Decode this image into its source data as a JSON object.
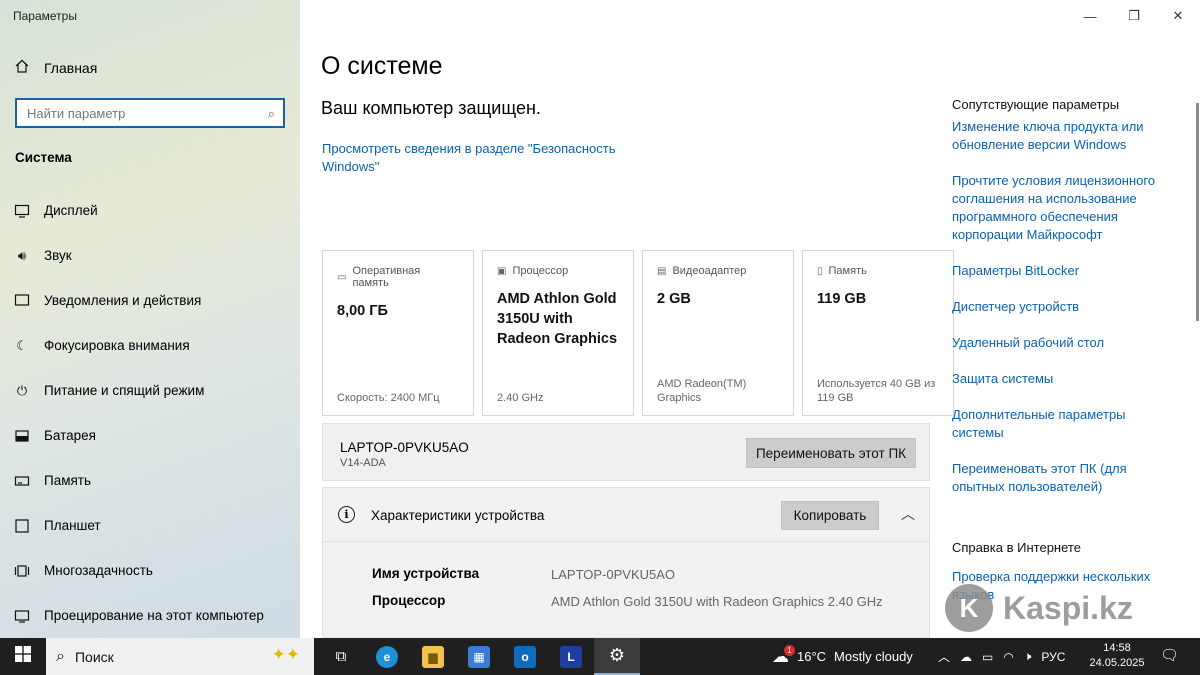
{
  "window": {
    "title": "Параметры",
    "controls": {
      "minimize": "—",
      "maximize": "❐",
      "close": "✕"
    }
  },
  "sidebar": {
    "home": {
      "icon": "home-icon",
      "label": "Главная"
    },
    "search": {
      "placeholder": "Найти параметр",
      "icon": "search-icon"
    },
    "section": "Система",
    "items": [
      {
        "icon": "display-icon",
        "label": "Дисплей"
      },
      {
        "icon": "sound-icon",
        "label": "Звук"
      },
      {
        "icon": "notifications-icon",
        "label": "Уведомления и действия"
      },
      {
        "icon": "focus-assist-icon",
        "label": "Фокусировка внимания"
      },
      {
        "icon": "power-icon",
        "label": "Питание и спящий режим"
      },
      {
        "icon": "battery-icon",
        "label": "Батарея"
      },
      {
        "icon": "storage-icon",
        "label": "Память"
      },
      {
        "icon": "tablet-icon",
        "label": "Планшет"
      },
      {
        "icon": "multitasking-icon",
        "label": "Многозадачность"
      },
      {
        "icon": "projecting-icon",
        "label": "Проецирование на этот компьютер"
      }
    ]
  },
  "main": {
    "title": "О системе",
    "protected": "Ваш компьютер защищен.",
    "security_link": "Просмотреть сведения в разделе \"Безопасность Windows\"",
    "cards": [
      {
        "icon": "ram-icon",
        "label": "Оперативная память",
        "value": "8,00 ГБ",
        "foot": "Скорость: 2400 МГц"
      },
      {
        "icon": "cpu-icon",
        "label": "Процессор",
        "value": "AMD Athlon Gold 3150U with Radeon Graphics",
        "foot": "2.40 GHz"
      },
      {
        "icon": "gpu-icon",
        "label": "Видеоадаптер",
        "value": "2 GB",
        "foot": "AMD Radeon(TM) Graphics"
      },
      {
        "icon": "storage-icon",
        "label": "Память",
        "value": "119 GB",
        "foot": "Используется 40 GB из 119 GB"
      }
    ],
    "pc": {
      "name": "LAPTOP-0PVKU5AO",
      "model": "V14-ADA",
      "rename_button": "Переименовать этот ПК"
    },
    "specs": {
      "title": "Характеристики устройства",
      "copy_button": "Копировать",
      "rows": [
        {
          "label": "Имя устройства",
          "value": "LAPTOP-0PVKU5AO"
        },
        {
          "label": "Процессор",
          "value": "AMD Athlon Gold 3150U with Radeon Graphics         2.40 GHz"
        }
      ]
    }
  },
  "related": {
    "heading": "Сопутствующие параметры",
    "links": [
      "Изменение ключа продукта или обновление версии Windows",
      "Прочтите условия лицензионного соглашения на использование программного обеспечения корпорации Майкрософт",
      "Параметры BitLocker",
      "Диспетчер устройств",
      "Удаленный рабочий стол",
      "Защита системы",
      "Дополнительные параметры системы",
      "Переименовать этот ПК (для опытных пользователей)"
    ],
    "help_heading": "Справка в Интернете",
    "help_link": "Проверка поддержки нескольких языков"
  },
  "watermark": {
    "logo_letter": "K",
    "text": "Kaspi.kz"
  },
  "taskbar": {
    "search_label": "Поиск",
    "apps": [
      {
        "icon": "task-view-icon",
        "glyph": "⧉"
      },
      {
        "icon": "edge-icon",
        "glyph": "e",
        "color": "#1f8fd8"
      },
      {
        "icon": "file-explorer-icon",
        "glyph": "▆",
        "color": "#f2c14e"
      },
      {
        "icon": "store-icon",
        "glyph": "▦",
        "color": "#3a7bd5"
      },
      {
        "icon": "outlook-icon",
        "glyph": "o",
        "color": "#0f6cbd"
      },
      {
        "icon": "l-app-icon",
        "glyph": "L",
        "color": "#1f3fa0"
      },
      {
        "icon": "settings-icon",
        "glyph": "⚙",
        "color": "#ffffff"
      }
    ],
    "weather": {
      "temp": "16°C",
      "desc": "Mostly cloudy",
      "badge": "1"
    },
    "tray": {
      "lang": "РУС"
    },
    "clock": {
      "time": "14:58",
      "date": "24.05.2025"
    }
  }
}
